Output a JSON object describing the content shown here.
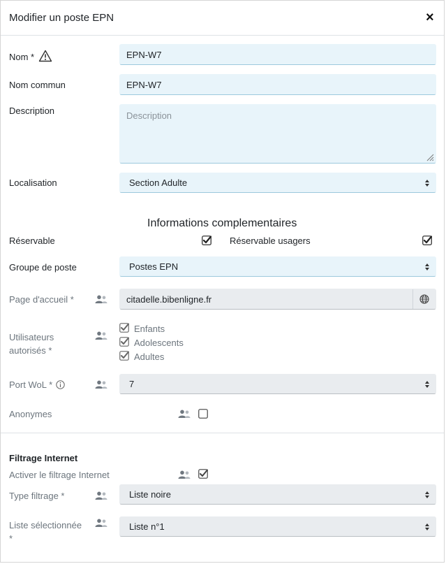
{
  "modal": {
    "title": "Modifier un poste EPN",
    "close": "×"
  },
  "fields": {
    "nom": {
      "label": "Nom *",
      "value": "EPN-W7"
    },
    "nom_commun": {
      "label": "Nom commun",
      "value": "EPN-W7"
    },
    "description": {
      "label": "Description",
      "placeholder": "Description",
      "value": ""
    },
    "localisation": {
      "label": "Localisation",
      "value": "Section Adulte"
    }
  },
  "info_section": {
    "title": "Informations complementaires",
    "reservable": {
      "label": "Réservable",
      "checked": true
    },
    "reservable_usagers": {
      "label": "Réservable usagers",
      "checked": true
    },
    "groupe": {
      "label": "Groupe de poste",
      "value": "Postes EPN"
    },
    "page_accueil": {
      "label": "Page d'accueil *",
      "value": "citadelle.bibenligne.fr"
    },
    "utilisateurs": {
      "label_line1": "Utilisateurs",
      "label_line2": "autorisés *",
      "options": [
        {
          "label": "Enfants",
          "checked": true
        },
        {
          "label": "Adolescents",
          "checked": true
        },
        {
          "label": "Adultes",
          "checked": true
        }
      ]
    },
    "port_wol": {
      "label": "Port WoL *",
      "value": "7"
    },
    "anonymes": {
      "label": "Anonymes",
      "checked": false
    }
  },
  "filtrage": {
    "title": "Filtrage Internet",
    "activer": {
      "label": "Activer le filtrage Internet",
      "checked": true
    },
    "type": {
      "label": "Type filtrage *",
      "value": "Liste noire"
    },
    "liste": {
      "label_line1": "Liste sélectionnée",
      "label_line2": "*",
      "value": "Liste n°1"
    }
  },
  "colors": {
    "field_bg": "#e8f4fa",
    "field_border": "#9cc9dd",
    "disabled_bg": "#e9ecef"
  }
}
